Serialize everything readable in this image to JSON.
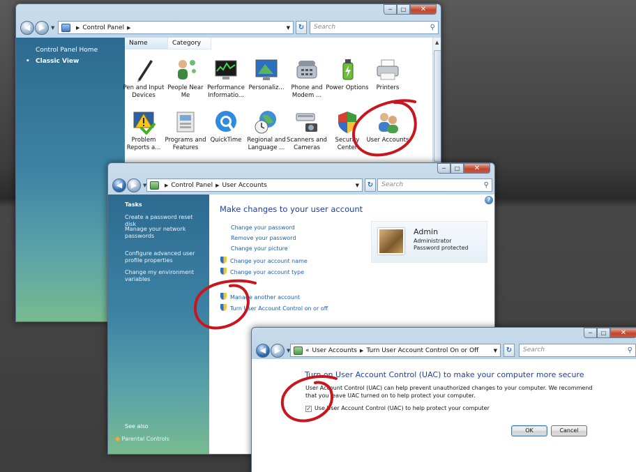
{
  "colors": {
    "title_blue": "#1f3fa0",
    "link_blue": "#1a5fb4",
    "annotation_red": "#c8161d"
  },
  "window1": {
    "address": {
      "crumbs": [
        "Control Panel"
      ]
    },
    "search_placeholder": "Search",
    "left_pane": {
      "home_link": "Control Panel Home",
      "view_label": "Classic View"
    },
    "columns": [
      "Name",
      "Category"
    ],
    "items": [
      {
        "label": "Pen and Input Devices",
        "icon": "pen-icon"
      },
      {
        "label": "People Near Me",
        "icon": "people-near-me-icon"
      },
      {
        "label": "Performance Informatio...",
        "icon": "performance-icon"
      },
      {
        "label": "Personaliz...",
        "icon": "personalization-icon"
      },
      {
        "label": "Phone and Modem ...",
        "icon": "phone-icon"
      },
      {
        "label": "Power Options",
        "icon": "power-icon"
      },
      {
        "label": "Printers",
        "icon": "printer-icon"
      },
      {
        "label": "Problem Reports a...",
        "icon": "problem-reports-icon"
      },
      {
        "label": "Programs and Features",
        "icon": "programs-icon"
      },
      {
        "label": "QuickTime",
        "icon": "quicktime-icon"
      },
      {
        "label": "Regional and Language ...",
        "icon": "globe-icon"
      },
      {
        "label": "Scanners and Cameras",
        "icon": "scanner-icon"
      },
      {
        "label": "Security Center",
        "icon": "security-shield-icon"
      },
      {
        "label": "User Accounts",
        "icon": "user-accounts-icon"
      }
    ]
  },
  "window2": {
    "address": {
      "crumbs": [
        "Control Panel",
        "User Accounts"
      ]
    },
    "search_placeholder": "Search",
    "tasks_heading": "Tasks",
    "tasks": [
      "Create a password reset disk",
      "Manage your network passwords",
      "Configure advanced user profile properties",
      "Change my environment variables"
    ],
    "see_also_heading": "See also",
    "see_also_link": "Parental Controls",
    "heading": "Make changes to your user account",
    "links": [
      {
        "label": "Change your password",
        "shield": false
      },
      {
        "label": "Remove your password",
        "shield": false
      },
      {
        "label": "Change your picture",
        "shield": false
      },
      {
        "label": "Change your account name",
        "shield": true
      },
      {
        "label": "Change your account type",
        "shield": true
      },
      {
        "label": "Manage another account",
        "shield": true
      },
      {
        "label": "Turn User Account Control on or off",
        "shield": true
      }
    ],
    "account": {
      "name": "Admin",
      "type": "Administrator",
      "status": "Password protected"
    }
  },
  "window3": {
    "address": {
      "prefix": "«",
      "crumbs": [
        "User Accounts",
        "Turn User Account Control On or Off"
      ]
    },
    "search_placeholder": "Search",
    "heading": "Turn on User Account Control (UAC) to make your computer more secure",
    "body": "User Account Control (UAC) can help prevent unauthorized changes to your computer.  We recommend that you leave UAC turned on to help protect your computer.",
    "checkbox_label": "Use User Account Control (UAC) to help protect your computer",
    "checkbox_checked": true,
    "ok_label": "OK",
    "cancel_label": "Cancel"
  }
}
